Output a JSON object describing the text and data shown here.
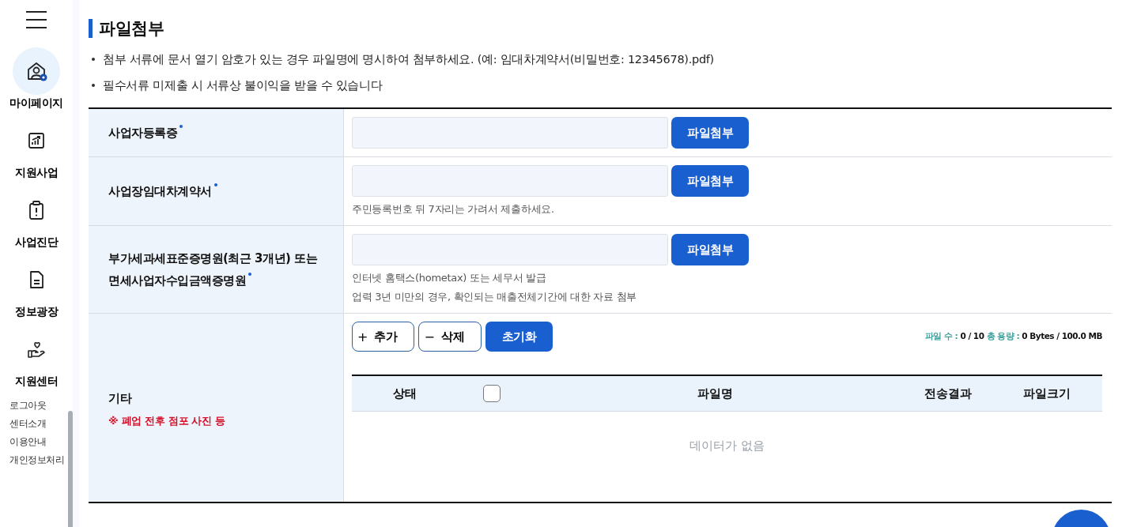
{
  "sidebar": {
    "items": [
      {
        "label": "마이페이지",
        "selected": true
      },
      {
        "label": "지원사업",
        "selected": false
      },
      {
        "label": "사업진단",
        "selected": false
      },
      {
        "label": "정보광장",
        "selected": false
      },
      {
        "label": "지원센터",
        "selected": false
      }
    ],
    "links": [
      "로그아웃",
      "센터소개",
      "이용안내",
      "개인정보처리"
    ]
  },
  "title": "파일첨부",
  "notes": [
    "첨부 서류에 문서 열기 암호가 있는 경우 파일명에 명시하여 첨부하세요. (예: 임대차계약서(비밀번호: 12345678).pdf)",
    "필수서류 미제출 시 서류상 불이익을 받을 수 있습니다"
  ],
  "form": {
    "rows": [
      {
        "label": "사업자등록증",
        "required": true,
        "button": "파일첨부"
      },
      {
        "label": "사업장임대차계약서",
        "required": true,
        "button": "파일첨부",
        "hints": [
          "주민등록번호 뒤 7자리는 가려서 제출하세요."
        ]
      },
      {
        "label": "부가세과세표준증명원(최근 3개년) 또는 면세사업자수입금액증명원",
        "required": true,
        "button": "파일첨부",
        "hints": [
          "인터넷 홈택스(hometax) 또는 세무서 발급",
          "업력 3년 미만의 경우, 확인되는 매출전체기간에 대한 자료 첨부"
        ]
      }
    ],
    "other": {
      "label": "기타",
      "note": "※ 폐업 전후 점포 사진 등",
      "buttons": [
        {
          "icon": "+",
          "label": "추가",
          "kind": "outline"
        },
        {
          "icon": "−",
          "label": "삭제",
          "kind": "outline"
        },
        {
          "label": "초기화",
          "kind": "primary"
        }
      ],
      "counter": {
        "count_label": "파일 수 :",
        "count": "0 / 10",
        "size_label": "총 용량 :",
        "size": "0 Bytes / 100.0 MB"
      },
      "table": {
        "columns": [
          "상태",
          "파일명",
          "전송결과",
          "파일크기"
        ],
        "select_all": {
          "checked": false
        },
        "empty": "데이터가 없음"
      }
    }
  }
}
